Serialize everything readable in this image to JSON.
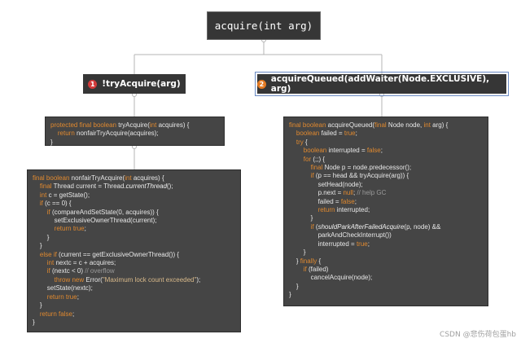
{
  "root": {
    "label": "acquire(int arg)"
  },
  "branches": {
    "left": {
      "badge": "1",
      "label": "!tryAcquire(arg)"
    },
    "right": {
      "badge": "2",
      "label": "acquireQueued(addWaiter(Node.EXCLUSIVE), arg)"
    }
  },
  "code_blocks": {
    "try_acquire": [
      "protected final boolean tryAcquire(int acquires) {",
      "    return nonfairTryAcquire(acquires);",
      "}"
    ],
    "nonfair_try_acquire": [
      "final boolean nonfairTryAcquire(int acquires) {",
      "    final Thread current = Thread.currentThread();",
      "    int c = getState();",
      "    if (c == 0) {",
      "        if (compareAndSetState(0, acquires)) {",
      "            setExclusiveOwnerThread(current);",
      "            return true;",
      "        }",
      "    }",
      "    else if (current == getExclusiveOwnerThread()) {",
      "        int nextc = c + acquires;",
      "        if (nextc < 0) // overflow",
      "            throw new Error(\"Maximum lock count exceeded\");",
      "        setState(nextc);",
      "        return true;",
      "    }",
      "    return false;",
      "}"
    ],
    "acquire_queued": [
      "final boolean acquireQueued(final Node node, int arg) {",
      "    boolean failed = true;",
      "    try {",
      "        boolean interrupted = false;",
      "        for (;;) {",
      "            final Node p = node.predecessor();",
      "            if (p == head && tryAcquire(arg)) {",
      "                setHead(node);",
      "                p.next = null; // help GC",
      "                failed = false;",
      "                return interrupted;",
      "            }",
      "            if (shouldParkAfterFailedAcquire(p, node) &&",
      "                parkAndCheckInterrupt())",
      "                interrupted = true;",
      "        }",
      "    } finally {",
      "        if (failed)",
      "            cancelAcquire(node);",
      "    }",
      "}"
    ]
  },
  "watermark": "CSDN @悲伤荷包蛋hb",
  "colors": {
    "node_bg": "#363636",
    "code_bg": "#454545",
    "keyword": "#e0892f",
    "method": "#f2c45a",
    "comment": "#9a9a9a",
    "badge_one": "#d23b3b",
    "badge_two": "#e47a22",
    "connector": "#b5b5b5",
    "selection": "#6b8bc4"
  }
}
